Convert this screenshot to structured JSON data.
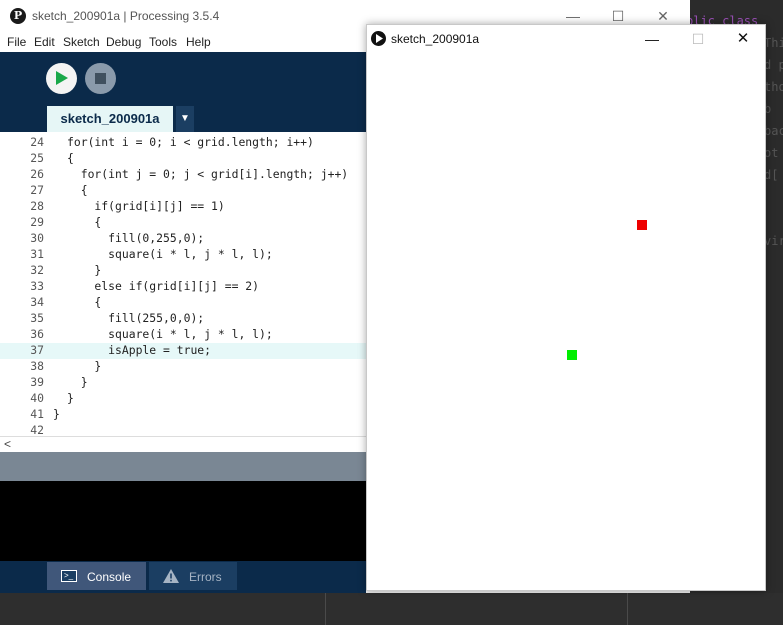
{
  "ide": {
    "title": "sketch_200901a | Processing 3.5.4",
    "logo_glyph": "P",
    "window_buttons": {
      "minimize": "—",
      "maximize": "☐",
      "close": "✕"
    },
    "menu": [
      "File",
      "Edit",
      "Sketch",
      "Debug",
      "Tools",
      "Help"
    ],
    "tab_label": "sketch_200901a",
    "tab_menu_glyph": "▼",
    "code_lines": [
      {
        "num": "24",
        "text": "for(int i = 0; i < grid.length; i++)"
      },
      {
        "num": "25",
        "text": "{"
      },
      {
        "num": "26",
        "text": "  for(int j = 0; j < grid[i].length; j++)"
      },
      {
        "num": "27",
        "text": "  {"
      },
      {
        "num": "28",
        "text": "    if(grid[i][j] == 1)"
      },
      {
        "num": "29",
        "text": "    {"
      },
      {
        "num": "30",
        "text": "      fill(0,255,0);"
      },
      {
        "num": "31",
        "text": "      square(i * l, j * l, l);"
      },
      {
        "num": "32",
        "text": "    }"
      },
      {
        "num": "33",
        "text": "    else if(grid[i][j] == 2)"
      },
      {
        "num": "34",
        "text": "    {"
      },
      {
        "num": "35",
        "text": "      fill(255,0,0);"
      },
      {
        "num": "36",
        "text": "      square(i * l, j * l, l);"
      },
      {
        "num": "37",
        "text": "      isApple = true;"
      },
      {
        "num": "38",
        "text": "    }"
      },
      {
        "num": "39",
        "text": "  }"
      },
      {
        "num": "40",
        "text": "}"
      },
      {
        "num": "41",
        "text": "}"
      },
      {
        "num": "42",
        "text": ""
      }
    ],
    "highlighted_line": "37",
    "scroll_left_glyph": "<",
    "console_tab": "Console",
    "errors_tab": "Errors"
  },
  "sketch_window": {
    "title": "sketch_200901a",
    "window_buttons": {
      "minimize": "—",
      "maximize": "☐",
      "close": "✕"
    },
    "apple_color": "#ee0000",
    "snake_color": "#00ee00"
  },
  "background_editor": {
    "lines": [
      "blic class ",
      "Thi",
      "d p",
      "tho",
      " b",
      "bac",
      "ot ",
      "d[",
      "",
      "",
      "vir"
    ]
  },
  "colors": {
    "toolbar": "#0b2a4a",
    "line_highlight": "#e6f8f8",
    "console": "#000000"
  }
}
